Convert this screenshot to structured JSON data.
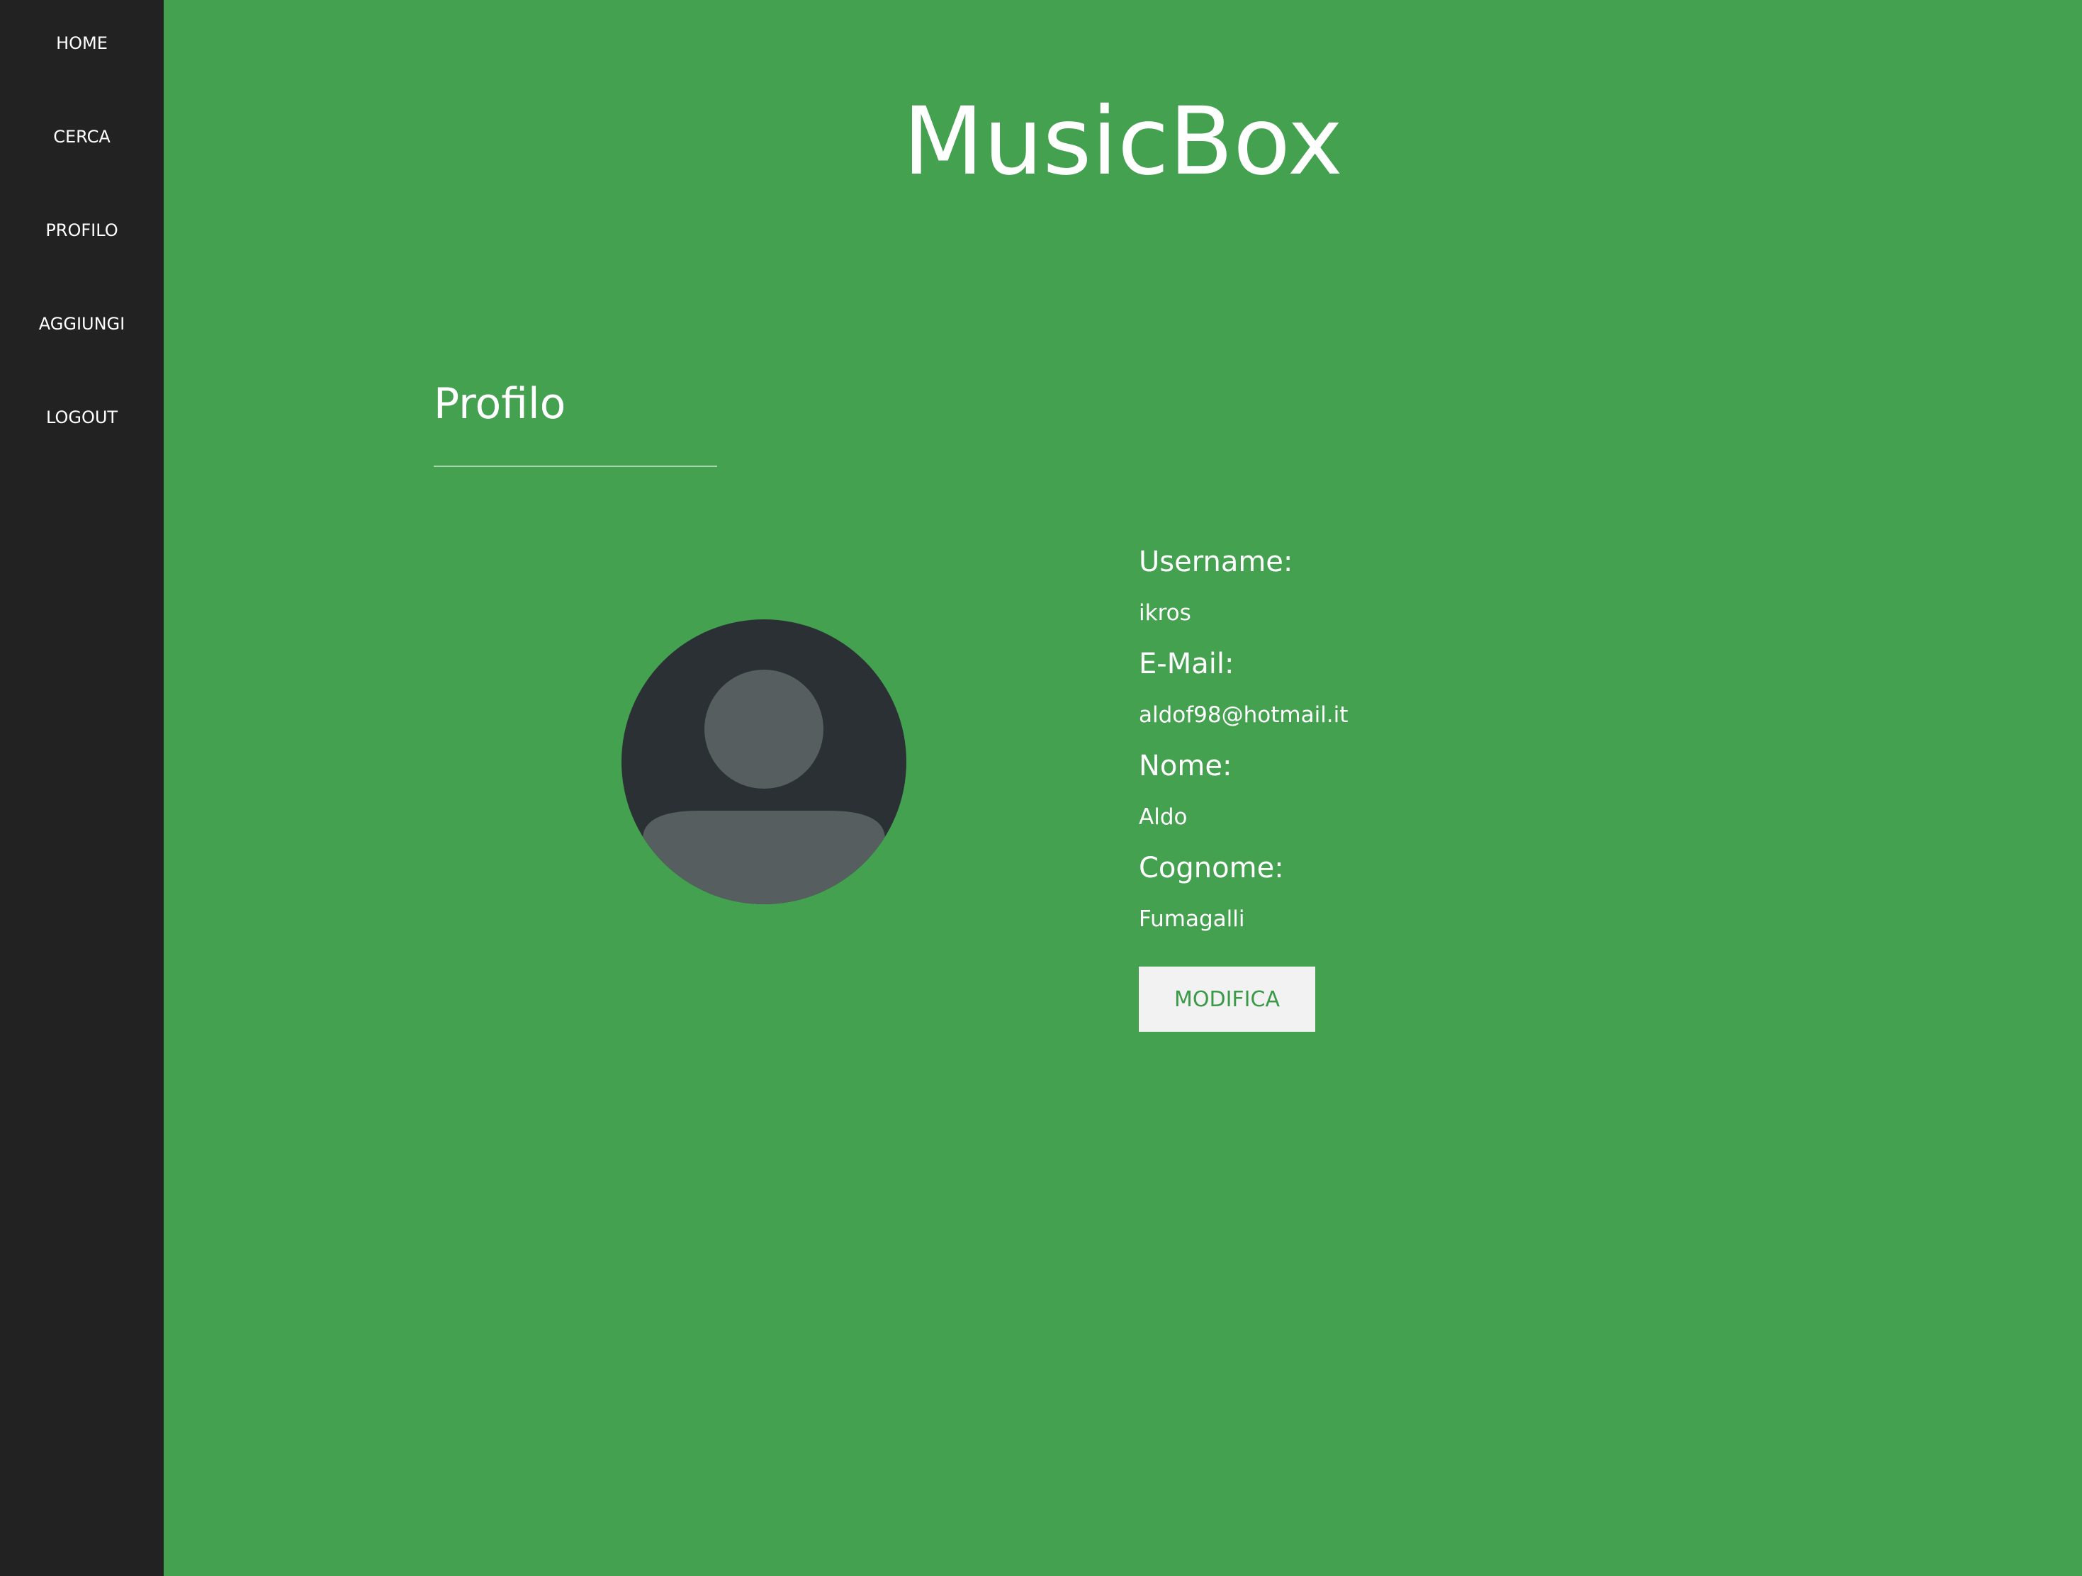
{
  "sidebar": {
    "items": [
      {
        "label": "HOME"
      },
      {
        "label": "CERCA"
      },
      {
        "label": "PROFILO"
      },
      {
        "label": "AGGIUNGI"
      },
      {
        "label": "LOGOUT"
      }
    ]
  },
  "header": {
    "title": "MusicBox"
  },
  "profile": {
    "section_title": "Profilo",
    "avatar_icon": "user-silhouette-icon",
    "fields": [
      {
        "label": "Username:",
        "value": "ikros"
      },
      {
        "label": "E-Mail:",
        "value": "aldof98@hotmail.it"
      },
      {
        "label": "Nome:",
        "value": "Aldo"
      },
      {
        "label": "Cognome:",
        "value": "Fumagalli"
      }
    ],
    "edit_button_label": "MODIFICA"
  },
  "colors": {
    "sidebar_bg": "#222222",
    "main_bg": "#43a150",
    "button_bg": "#f2f2f2",
    "button_text": "#3a9a48",
    "avatar_bg": "#2a3033",
    "avatar_fg": "#565e5f"
  }
}
